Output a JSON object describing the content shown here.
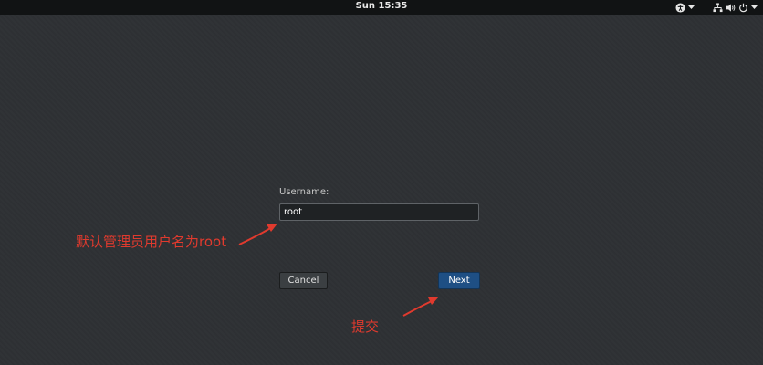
{
  "topbar": {
    "clock": "Sun 15:35",
    "icons": [
      "accessibility-icon",
      "chevron-down-icon",
      "network-icon",
      "volume-icon",
      "power-icon",
      "chevron-down-icon"
    ]
  },
  "form": {
    "username_label": "Username:",
    "username_value": "root",
    "cancel_label": "Cancel",
    "next_label": "Next"
  },
  "annotations": {
    "admin_note": "默认管理员用户名为root",
    "submit_note": "提交",
    "color": "#e03a2e"
  },
  "colors": {
    "background": "#2e3134",
    "topbar": "#111314",
    "next_button": "#1e4f84"
  }
}
